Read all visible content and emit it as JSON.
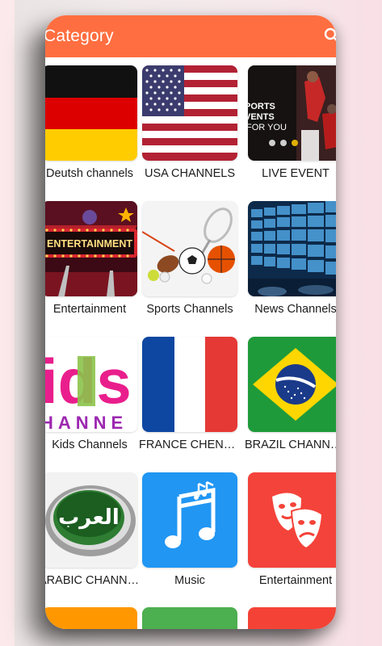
{
  "appbar": {
    "title": "Category"
  },
  "categories": [
    {
      "label": "Deutsh channels",
      "icon": "germany-flag-icon"
    },
    {
      "label": "USA CHANNELS",
      "icon": "usa-flag-icon"
    },
    {
      "label": "LIVE EVENT",
      "icon": "live-event-icon",
      "image_text": [
        "PORTS",
        "VENTS",
        "FOR YOU"
      ]
    },
    {
      "label": "Entertainment",
      "icon": "entertainment-marquee-icon",
      "image_text": "ENTERTAINMENT"
    },
    {
      "label": "Sports Channels",
      "icon": "sports-balls-icon"
    },
    {
      "label": "News Channels",
      "icon": "news-screens-icon"
    },
    {
      "label": "Kids Channels",
      "icon": "kids-channel-logo-icon",
      "image_text": [
        "ids",
        "HANNE"
      ]
    },
    {
      "label": "FRANCE CHENNELS",
      "icon": "france-flag-icon"
    },
    {
      "label": "BRAZIL CHANNELS",
      "icon": "brazil-flag-icon"
    },
    {
      "label": "ARABIC CHANNELS",
      "icon": "alarabiya-logo-icon",
      "image_text": "العرب"
    },
    {
      "label": "Music",
      "icon": "music-note-icon"
    },
    {
      "label": "Entertainment",
      "icon": "theater-masks-icon"
    }
  ],
  "colors": {
    "appbar": "#ff6e40",
    "music_tile": "#2196f3",
    "masks_tile": "#f4433a",
    "partial_row": [
      "#ff9800",
      "#4caf50",
      "#f44336"
    ]
  }
}
